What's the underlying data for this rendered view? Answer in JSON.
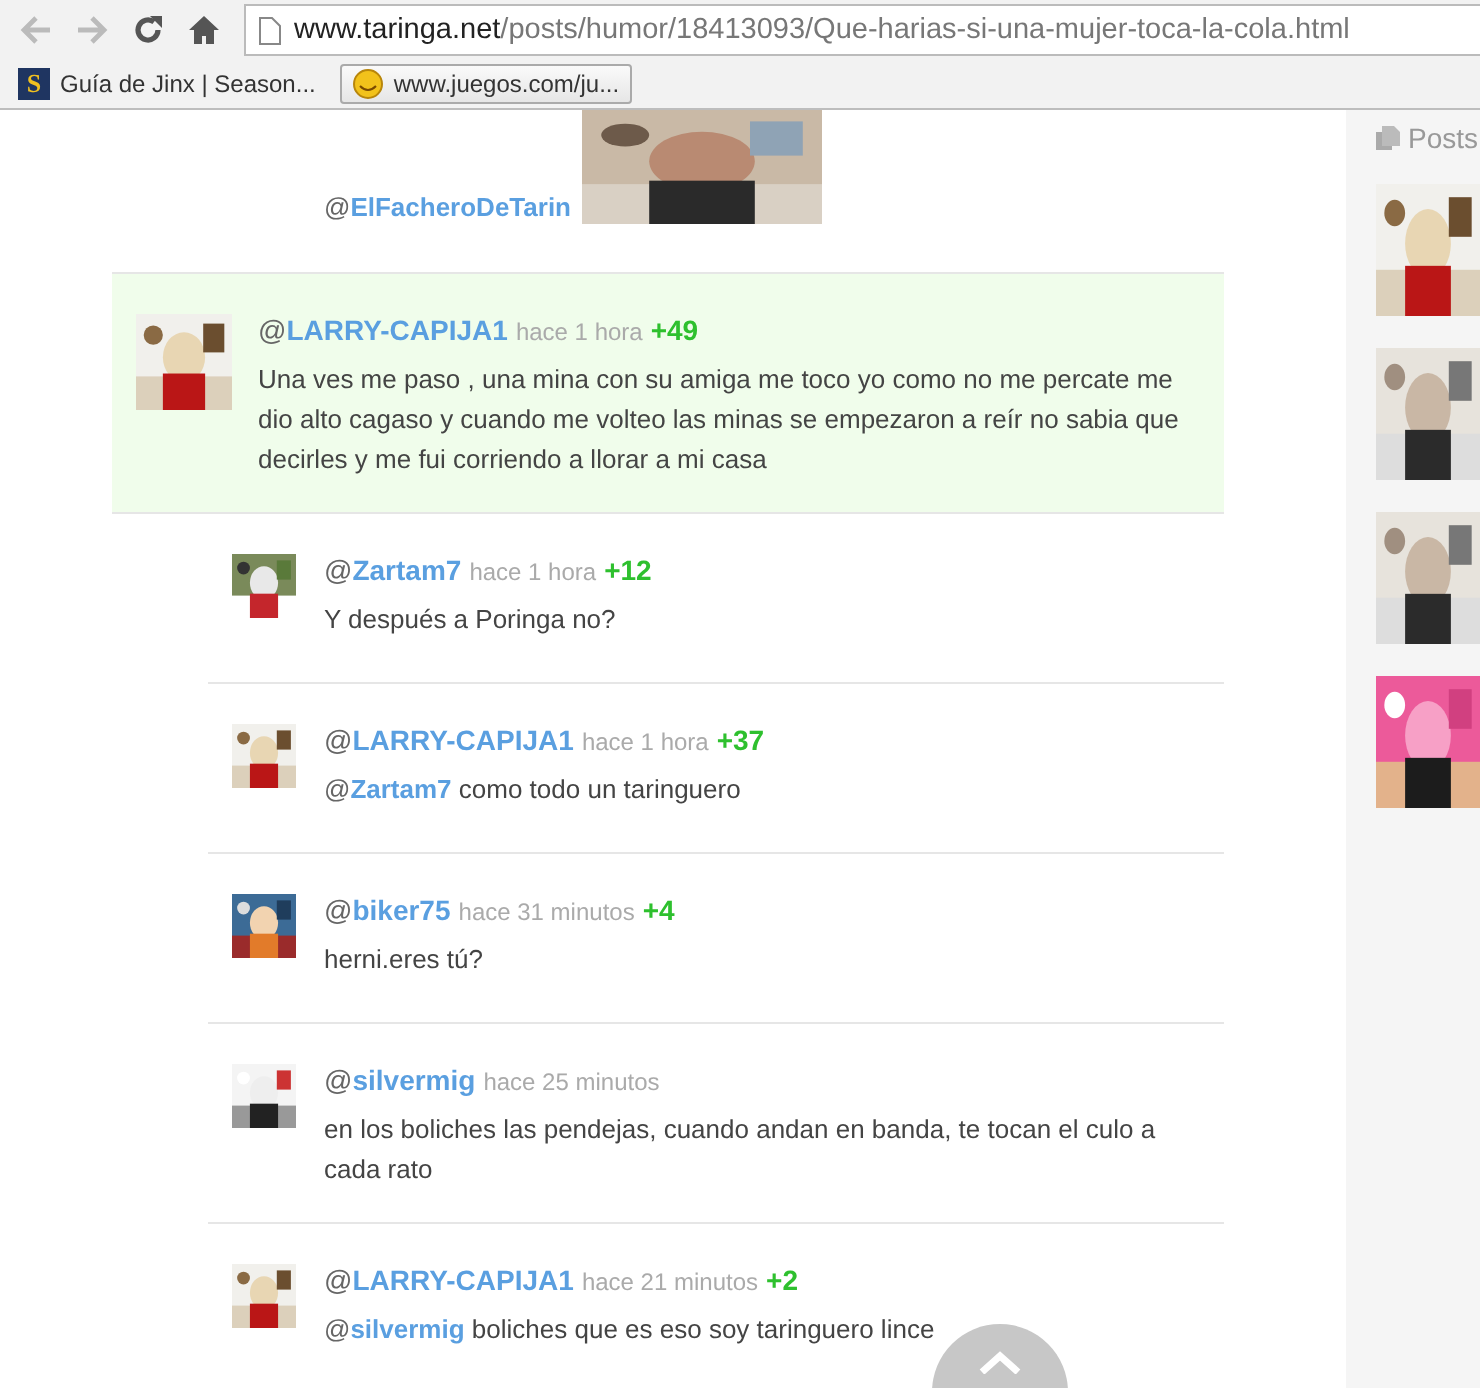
{
  "browser": {
    "address": {
      "domain": "www.taringa.net",
      "path": "/posts/humor/18413093/Que-harias-si-una-mujer-toca-la-cola.html"
    },
    "bookmarks": [
      {
        "icon_letter": "S",
        "label": "Guía de Jinx | Season...",
        "selected": false
      },
      {
        "label": "www.juegos.com/ju...",
        "selected": true
      }
    ]
  },
  "top_comment": {
    "prefix": "@",
    "user": "ElFacheroDeTarin"
  },
  "comments": [
    {
      "prefix": "@",
      "user": "LARRY-CAPIJA1",
      "time": "hace 1 hora",
      "score": "+49",
      "highlighted": true,
      "text": "Una ves me paso , una mina con su amiga me toco yo como no me percate me dio alto cagaso y cuando me volteo las minas se empezaron a reír no sabia que decirles y me fui corriendo a llorar a mi casa",
      "children": [
        {
          "prefix": "@",
          "user": "Zartam7",
          "time": "hace 1 hora",
          "score": "+12",
          "highlighted": false,
          "text": "Y después a Poringa no?"
        },
        {
          "prefix": "@",
          "user": "LARRY-CAPIJA1",
          "time": "hace 1 hora",
          "score": "+37",
          "highlighted": false,
          "mention": {
            "prefix": "@",
            "user": "Zartam7"
          },
          "text": "como todo un taringuero"
        },
        {
          "prefix": "@",
          "user": "biker75",
          "time": "hace 31 minutos",
          "score": "+4",
          "highlighted": false,
          "text": "herni.eres tú?"
        },
        {
          "prefix": "@",
          "user": "silvermig",
          "time": "hace 25 minutos",
          "highlighted": false,
          "text": "en los boliches las pendejas, cuando andan en banda, te tocan el culo a cada rato"
        },
        {
          "prefix": "@",
          "user": "LARRY-CAPIJA1",
          "time": "hace 21 minutos",
          "score": "+2",
          "highlighted": false,
          "mention": {
            "prefix": "@",
            "user": "silvermig"
          },
          "text": "boliches que es eso soy taringuero lince"
        }
      ]
    }
  ],
  "sidebar": {
    "title": "Posts"
  }
}
